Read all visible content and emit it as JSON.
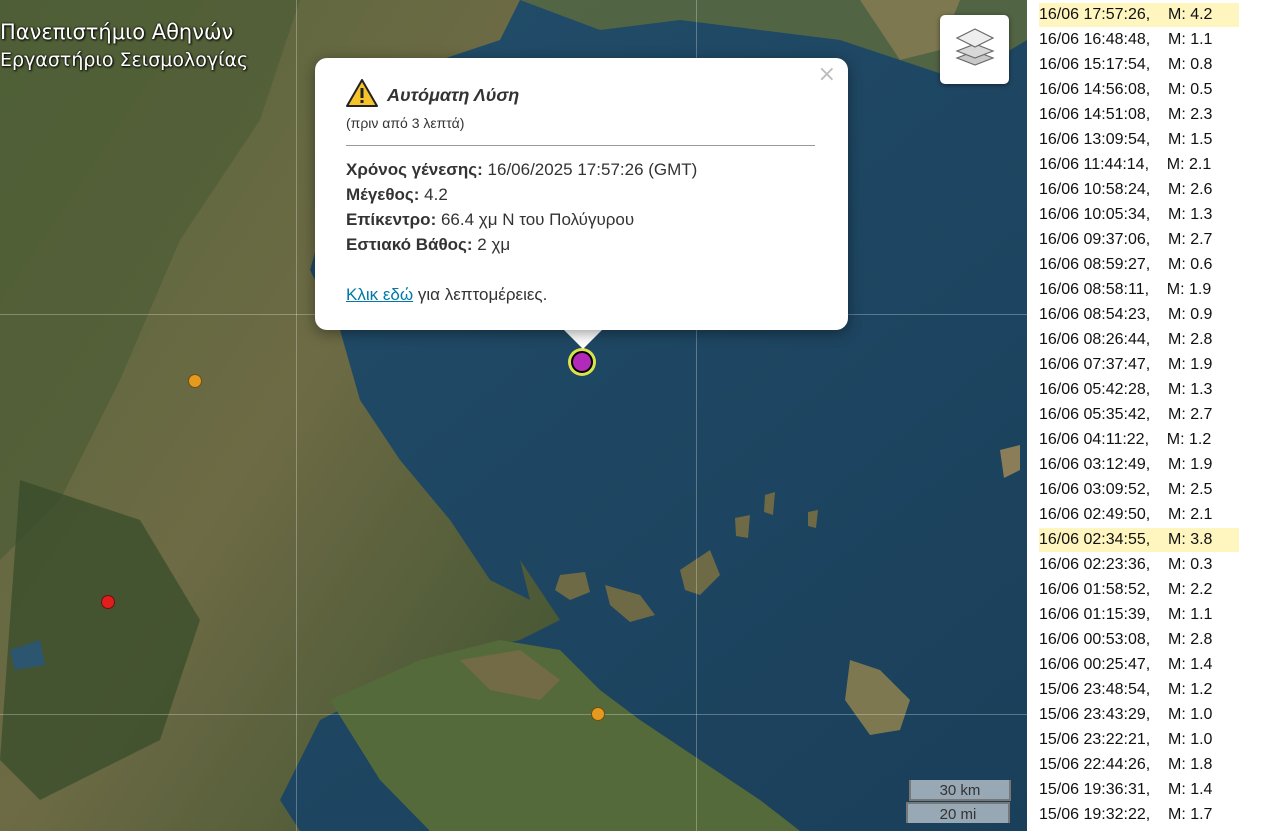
{
  "watermark": {
    "line1": "Πανεπιστήμιο Αθηνών",
    "line2": "Εργαστήριο Σεισμολογίας"
  },
  "map": {
    "layers_control_icon": "layers-icon",
    "markers": [
      {
        "name": "epicenter-marker",
        "color": "#b22ab9",
        "selected": true
      },
      {
        "name": "orange-marker",
        "color": "#e39a1e"
      },
      {
        "name": "orange-marker",
        "color": "#e39a1e"
      },
      {
        "name": "red-marker",
        "color": "#e01e1e"
      }
    ],
    "scale": {
      "km": "30 km",
      "mi": "20 mi"
    }
  },
  "popup": {
    "warning_icon": "warning-icon",
    "title": "Αυτόματη Λύση",
    "subtitle": "(πριν από 3 λεπτά)",
    "close": "×",
    "fields": [
      {
        "label": "Χρόνος γένεσης:",
        "value": "16/06/2025 17:57:26 (GMT)"
      },
      {
        "label": "Μέγεθος:",
        "value": "4.2"
      },
      {
        "label": "Επίκεντρο:",
        "value": "66.4 χμ Ν του Πολύγυρου"
      },
      {
        "label": "Εστιακό Βάθος:",
        "value": "2 χμ"
      }
    ],
    "link_text": "Κλικ εδώ",
    "link_suffix": " για λεπτομέρειες."
  },
  "quake_list": [
    {
      "text": "16/06 17:57:26,    M: 4.2",
      "highlight": true
    },
    {
      "text": "16/06 16:48:48,    M: 1.1"
    },
    {
      "text": "16/06 15:17:54,    M: 0.8"
    },
    {
      "text": "16/06 14:56:08,    M: 0.5"
    },
    {
      "text": "16/06 14:51:08,    M: 2.3"
    },
    {
      "text": "16/06 13:09:54,    M: 1.5"
    },
    {
      "text": "16/06 11:44:14,    M: 2.1"
    },
    {
      "text": "16/06 10:58:24,    M: 2.6"
    },
    {
      "text": "16/06 10:05:34,    M: 1.3"
    },
    {
      "text": "16/06 09:37:06,    M: 2.7"
    },
    {
      "text": "16/06 08:59:27,    M: 0.6"
    },
    {
      "text": "16/06 08:58:11,    M: 1.9"
    },
    {
      "text": "16/06 08:54:23,    M: 0.9"
    },
    {
      "text": "16/06 08:26:44,    M: 2.8"
    },
    {
      "text": "16/06 07:37:47,    M: 1.9"
    },
    {
      "text": "16/06 05:42:28,    M: 1.3"
    },
    {
      "text": "16/06 05:35:42,    M: 2.7"
    },
    {
      "text": "16/06 04:11:22,    M: 1.2"
    },
    {
      "text": "16/06 03:12:49,    M: 1.9"
    },
    {
      "text": "16/06 03:09:52,    M: 2.5"
    },
    {
      "text": "16/06 02:49:50,    M: 2.1"
    },
    {
      "text": "16/06 02:34:55,    M: 3.8",
      "highlight": true
    },
    {
      "text": "16/06 02:23:36,    M: 0.3"
    },
    {
      "text": "16/06 01:58:52,    M: 2.2"
    },
    {
      "text": "16/06 01:15:39,    M: 1.1"
    },
    {
      "text": "16/06 00:53:08,    M: 2.8"
    },
    {
      "text": "16/06 00:25:47,    M: 1.4"
    },
    {
      "text": "15/06 23:48:54,    M: 1.2"
    },
    {
      "text": "15/06 23:43:29,    M: 1.0"
    },
    {
      "text": "15/06 23:22:21,    M: 1.0"
    },
    {
      "text": "15/06 22:44:26,    M: 1.8"
    },
    {
      "text": "15/06 19:36:31,    M: 1.4"
    },
    {
      "text": "15/06 19:32:22,    M: 1.7"
    }
  ]
}
